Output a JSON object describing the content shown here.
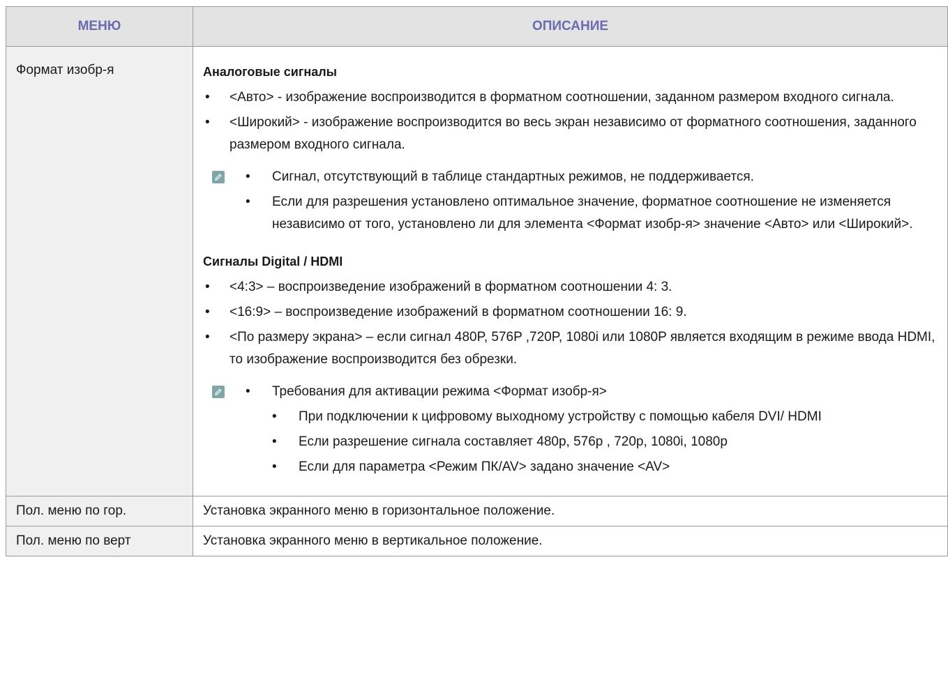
{
  "header": {
    "menu": "МЕНЮ",
    "description": "ОПИСАНИЕ"
  },
  "rows": {
    "format": {
      "menu": "Формат изобр-я",
      "analog": {
        "title": "Аналоговые сигналы",
        "items": [
          "<Авто> - изображение воспроизводится в форматном соотношении, заданном размером входного сигнала.",
          "<Широкий> - изображение воспроизводится во весь экран независимо от форматного соотношения, заданного размером входного сигнала."
        ],
        "note_icon": "pencil-note-icon",
        "notes": [
          "Сигнал, отсутствующий в таблице стандартных режимов, не поддерживается.",
          "Если для разрешения установлено оптимальное значение, форматное соотношение не изменяется независимо от того, установлено ли для элемента <Формат изобр-я> значение <Авто> или <Широкий>."
        ]
      },
      "digital": {
        "title": "Сигналы Digital / HDMI",
        "items": [
          "<4:3> – воспроизведение изображений в форматном соотношении 4: 3.",
          "<16:9> – воспроизведение изображений в форматном соотношении 16: 9.",
          "<По размеру экрана> – если сигнал 480P, 576P ,720P, 1080i или 1080P является входящим в режиме ввода HDMI, то изображение воспроизводится без обрезки."
        ],
        "note_icon": "pencil-note-icon",
        "note_main": "Требования для активации режима <Формат изобр-я>",
        "note_sub": [
          "При подключении к цифровому выходному устройству с помощью кабеля DVI/ HDMI",
          "Если разрешение сигнала составляет 480p, 576p , 720p, 1080i, 1080p",
          "Если для параметра <Режим ПК/AV> задано значение <AV>"
        ]
      }
    },
    "hpos": {
      "menu": "Пол. меню по гор.",
      "description": "Установка экранного меню в горизонтальное положение."
    },
    "vpos": {
      "menu": "Пол. меню по верт",
      "description": "Установка экранного меню в вертикальное положение."
    }
  },
  "colors": {
    "header_text": "#6b6bb0",
    "header_bg": "#e3e3e3",
    "menu_bg": "#f0f0f0",
    "note_icon_bg": "#7fa6a8",
    "border": "#9a9a9a"
  }
}
